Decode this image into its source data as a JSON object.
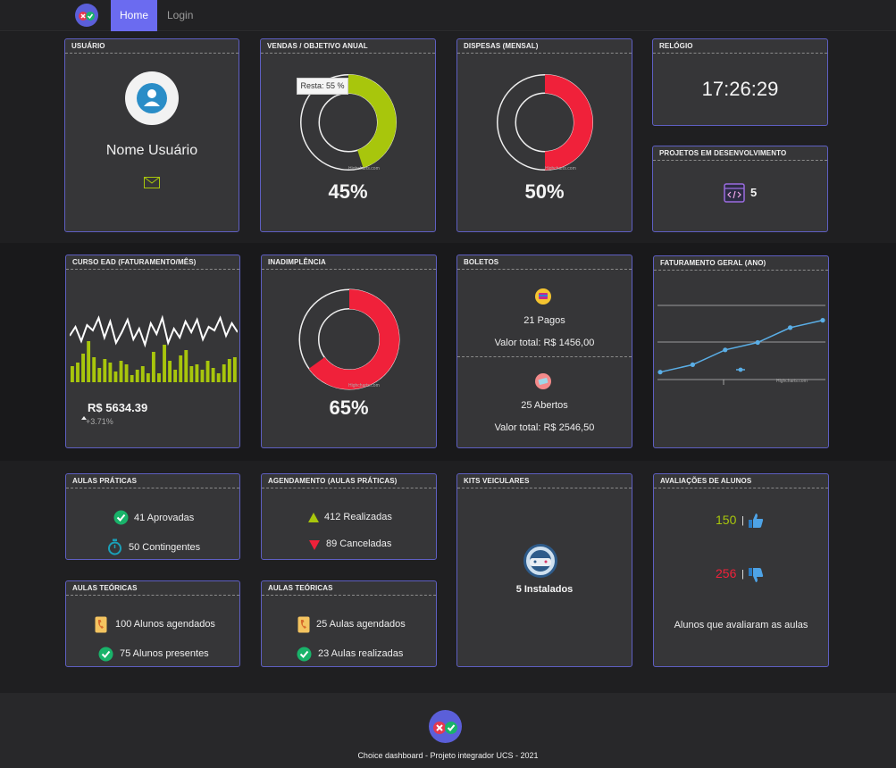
{
  "nav": {
    "home": "Home",
    "login": "Login"
  },
  "cards": {
    "usuario": {
      "title": "USUÁRIO",
      "name": "Nome Usuário"
    },
    "vendas": {
      "title": "VENDAS / OBJETIVO ANUAL",
      "tooltip": "Resta: 55 %",
      "percent": "45%",
      "credit": "Highcharts.com",
      "fill": 0.45,
      "color": "#a8c60c"
    },
    "despesas": {
      "title": "DISPESAS (MENSAL)",
      "percent": "50%",
      "credit": "Highcharts.com",
      "fill": 0.5,
      "color": "#f0213a"
    },
    "relogio": {
      "title": "RELÓGIO",
      "time": "17:26:29"
    },
    "projetos": {
      "title": "PROJETOS EM DESENVOLVIMENTO",
      "count": "5"
    },
    "curso": {
      "title": "CURSO EAD (FATURAMENTO/MÊS)",
      "value": "R$ 5634.39",
      "change": "+3.71%"
    },
    "inadimplencia": {
      "title": "INADIMPLÊNCIA",
      "percent": "65%",
      "credit": "Highcharts.com",
      "fill": 0.65,
      "color": "#f0213a"
    },
    "boletos": {
      "title": "BOLETOS",
      "pagos": "21 Pagos",
      "pagos_total": "Valor total: R$ 1456,00",
      "abertos": "25 Abertos",
      "abertos_total": "Valor total: R$ 2546,50"
    },
    "faturamento": {
      "title": "FATURAMENTO GERAL (ANO)",
      "credit": "Highcharts.com"
    },
    "praticas": {
      "title": "AULAS PRÁTICAS",
      "aprovadas": "41 Aprovadas",
      "contingentes": "50 Contingentes"
    },
    "agendamento": {
      "title": "AGENDAMENTO (AULAS PRÁTICAS)",
      "realizadas": "412 Realizadas",
      "canceladas": "89 Canceladas"
    },
    "kits": {
      "title": "KITS VEICULARES",
      "instalados": "5 Instalados"
    },
    "avaliacoes": {
      "title": "AVALIAÇÕES DE ALUNOS",
      "positivas": "150",
      "negativas": "256",
      "sep": "|",
      "caption": "Alunos que avaliaram as aulas"
    },
    "teoricas1": {
      "title": "AULAS TEÓRICAS",
      "agendados": "100 Alunos agendados",
      "presentes": "75 Alunos presentes"
    },
    "teoricas2": {
      "title": "AULAS TEÓRICAS",
      "agendadas": "25 Aulas agendados",
      "realizadas": "23 Aulas realizadas"
    }
  },
  "footer": {
    "text": "Choice dashboard - Projeto integrador UCS - 2021"
  },
  "chart_data": [
    {
      "type": "line",
      "title": "",
      "series": [
        {
          "values": [
            2.6,
            3.1,
            2.3,
            3.2,
            2.9,
            3.6,
            2.5,
            3.4,
            2.2,
            2.8,
            3.5,
            2.4,
            3.0,
            2.1,
            3.3,
            2.7,
            3.6,
            2.2,
            3.0,
            2.5,
            3.4,
            2.8,
            3.5,
            2.4,
            3.1,
            2.9,
            3.6,
            2.6,
            3.3,
            2.8
          ]
        },
        {
          "type": "bar",
          "values": [
            0.9,
            1.1,
            1.6,
            2.3,
            1.4,
            0.8,
            1.3,
            1.1,
            0.6,
            1.2,
            1.0,
            0.4,
            0.7,
            0.9,
            0.5,
            1.7,
            0.5,
            2.1,
            1.2,
            0.7,
            1.5,
            1.8,
            0.9,
            1.0,
            0.7,
            1.2,
            0.8,
            0.5,
            1.0,
            1.3,
            1.4
          ]
        }
      ]
    },
    {
      "type": "line",
      "title": "",
      "series": [
        {
          "values": [
            1,
            2,
            4,
            5,
            7,
            8
          ]
        }
      ]
    }
  ]
}
